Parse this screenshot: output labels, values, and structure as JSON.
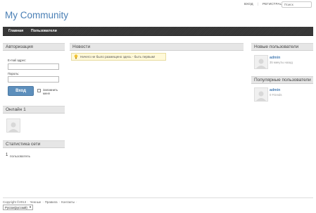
{
  "site": {
    "title": "My Community"
  },
  "top_links": {
    "login": "ВХОД",
    "register": "РЕГИСТРАЦИЯ",
    "separator": "|"
  },
  "search": {
    "placeholder": "Поиск"
  },
  "nav": {
    "items": [
      "Главная",
      "Пользователи"
    ]
  },
  "auth": {
    "title": "Авторизация",
    "email_label": "E-mail адрес:",
    "email_value": "",
    "password_label": "Пароль:",
    "password_value": "",
    "login_button": "Вход",
    "remember_label": "Запомнить меня"
  },
  "online": {
    "title": "Онлайн 1",
    "avatar_icon": "default-avatar-icon"
  },
  "stats": {
    "title": "Статистика сети",
    "count": "1",
    "label": "пользователь"
  },
  "news": {
    "title": "Новости",
    "notice_icon": "lightbulb-icon",
    "notice_text": "Ничего не было размещено здесь - быть первым!"
  },
  "new_users": {
    "title": "Новые пользователи",
    "user": {
      "name": "admin",
      "meta": "35 минуты назад"
    }
  },
  "popular_users": {
    "title": "Популярные пользователи",
    "user": {
      "name": "admin",
      "meta": "0 Friends"
    }
  },
  "footer": {
    "copyright": "Copyright ©2013",
    "links": [
      "Ченные",
      "Правила",
      "Контакты"
    ],
    "language": "Русски(русский)"
  },
  "colors": {
    "accent": "#4a7fb5",
    "navbar": "#333333",
    "button": "#5d8fbc",
    "notice_bg": "#fff9d8"
  }
}
